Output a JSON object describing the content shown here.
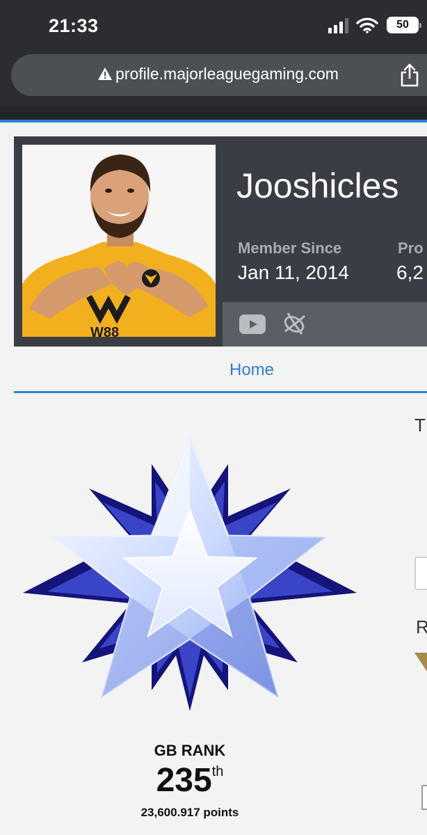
{
  "status_bar": {
    "time": "21:33",
    "battery": "50"
  },
  "browser": {
    "url": "profile.majorleaguegaming.com",
    "icons": [
      "warning-icon",
      "share-icon"
    ]
  },
  "profile": {
    "username": "Jooshicles",
    "member_since_label": "Member Since",
    "member_since_value": "Jan 11, 2014",
    "second_label": "Pro",
    "second_value": "6,2",
    "social_icons": [
      "youtube-icon",
      "battlenet-icon"
    ]
  },
  "tabs": {
    "active": "Home"
  },
  "rank": {
    "title": "GB RANK",
    "number": "235",
    "suffix": "th",
    "points": "23,600.917 points"
  },
  "side_column": {
    "heading_fragment": "T",
    "second_fragment": "R"
  },
  "colors": {
    "accent": "#2f7fd0",
    "header_bg": "#3a3d44",
    "chrome_bg": "#2b2d31",
    "jersey": "#f2b01e"
  }
}
